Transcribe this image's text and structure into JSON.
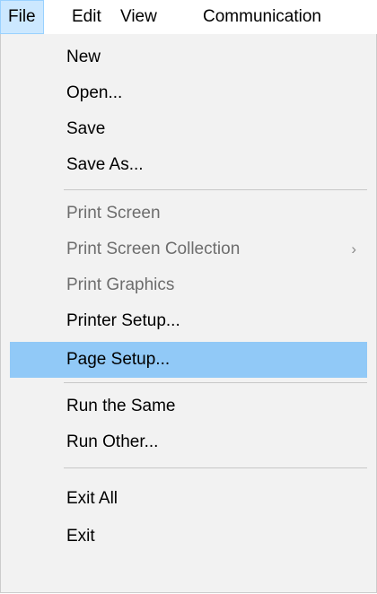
{
  "menubar": {
    "items": [
      {
        "label": "File"
      },
      {
        "label": "Edit"
      },
      {
        "label": "View"
      },
      {
        "label": "Communication"
      }
    ]
  },
  "file_menu": {
    "items": [
      {
        "label": "New",
        "enabled": true
      },
      {
        "label": "Open...",
        "enabled": true
      },
      {
        "label": "Save",
        "enabled": true
      },
      {
        "label": "Save As...",
        "enabled": true
      },
      {
        "label": "Print Screen",
        "enabled": false
      },
      {
        "label": "Print Screen Collection",
        "enabled": false,
        "submenu_icon": "chevron-right-icon",
        "submenu_glyph": "›"
      },
      {
        "label": "Print Graphics",
        "enabled": false
      },
      {
        "label": "Printer Setup...",
        "enabled": true
      },
      {
        "label": "Page Setup...",
        "enabled": true,
        "highlighted": true
      },
      {
        "label": "Run the Same",
        "enabled": true
      },
      {
        "label": "Run Other...",
        "enabled": true
      },
      {
        "label": "Exit All",
        "enabled": true
      },
      {
        "label": "Exit",
        "enabled": true
      }
    ]
  },
  "colors": {
    "active_menubar_bg": "#cce8ff",
    "highlight_bg": "#91c9f7",
    "menu_bg": "#f2f2f2",
    "disabled_text": "#6d6d6d"
  }
}
